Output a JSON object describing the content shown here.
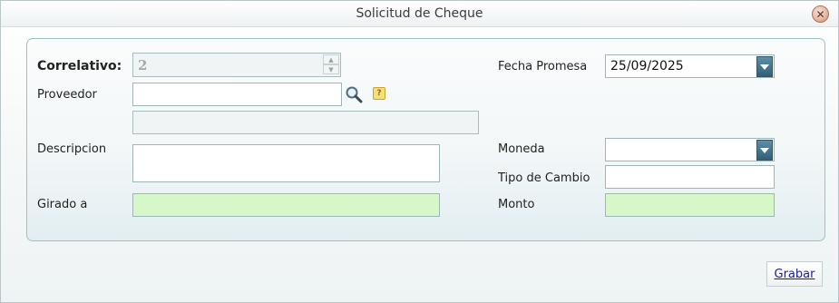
{
  "window": {
    "title": "Solicitud de Cheque",
    "close_icon": "close-icon"
  },
  "form": {
    "correlativo": {
      "label": "Correlativo:",
      "value": "2"
    },
    "proveedor": {
      "label": "Proveedor",
      "value": "",
      "name_value": ""
    },
    "descripcion": {
      "label": "Descripcion",
      "value": ""
    },
    "girado_a": {
      "label": "Girado a",
      "value": ""
    },
    "fecha_promesa": {
      "label": "Fecha Promesa",
      "value": "25/09/2025"
    },
    "moneda": {
      "label": "Moneda",
      "value": ""
    },
    "tipo_cambio": {
      "label": "Tipo de Cambio",
      "value": ""
    },
    "monto": {
      "label": "Monto",
      "value": ""
    }
  },
  "actions": {
    "save_label": "Grabar"
  },
  "colors": {
    "accent": "#335f75",
    "required_field": "#d6f8c8",
    "panel_border": "#9cc1c3"
  }
}
